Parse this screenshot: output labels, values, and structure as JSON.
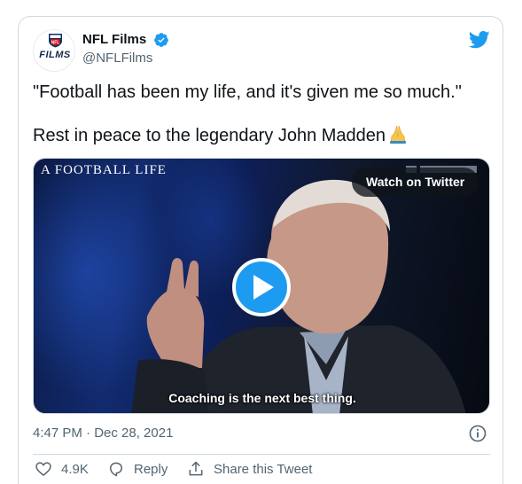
{
  "tweet": {
    "display_name": "NFL Films",
    "handle": "@NFLFilms",
    "avatar_logo_text": "FILMS",
    "text_line1": "\"Football has been my life, and it's given me so much.\"",
    "text_line2": "Rest in peace to the legendary John Madden",
    "emoji": "folded-hands",
    "timestamp": "4:47 PM · Dec 28, 2021"
  },
  "media": {
    "overlay_title": "A FOOTBALL LIFE",
    "watch_label": "Watch on Twitter",
    "caption": "Coaching is the next best thing."
  },
  "actions": {
    "likes": "4.9K",
    "reply_label": "Reply",
    "share_label": "Share this Tweet"
  },
  "colors": {
    "accent": "#1d9bf0",
    "text": "#0f1419",
    "secondary_text": "#536471",
    "border": "#cfd9de"
  },
  "icons": [
    "nfl-films-logo",
    "verified-icon",
    "twitter-bird-icon",
    "play-icon",
    "info-icon",
    "heart-icon",
    "reply-icon",
    "share-icon"
  ]
}
